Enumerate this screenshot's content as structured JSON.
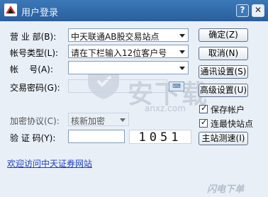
{
  "titlebar": {
    "title": "用户登录",
    "help_glyph": "?",
    "close_glyph": "✕"
  },
  "form": {
    "branch_label": "营 业 部(B):",
    "branch_value": "中天联通AB股交易站点",
    "account_type_label": "帐号类型(L):",
    "account_type_value": "请在下栏输入12位客户号",
    "account_label": "帐    号(A):",
    "account_value": "",
    "password_label": "交易密码(G):",
    "keyboard_icon_text": "⌨",
    "encrypt_label": "加密协议(C):",
    "encrypt_value": "核新加密",
    "captcha_label": "验 证 码(Y):",
    "captcha_input": "",
    "captcha_code": "1051"
  },
  "buttons": {
    "ok": "确定(Z)",
    "cancel": "取消(N)",
    "comm_settings": "通讯设置(S)",
    "advanced": "高级设置(U)",
    "test_speed": "主站测速(I)"
  },
  "checkboxes": {
    "save_account": {
      "label": "保存帐户",
      "checked": true
    },
    "fastest_site": {
      "label": "连最快站点",
      "checked": true
    }
  },
  "link_text": "欢迎访问中天证券网站",
  "watermark": {
    "text": "安下载",
    "sub": "anxz.com",
    "corner": "闪电下单"
  },
  "colors": {
    "titlebar": "#2a5f9c",
    "link": "#1a3fbf",
    "background": "#e9eff7"
  }
}
